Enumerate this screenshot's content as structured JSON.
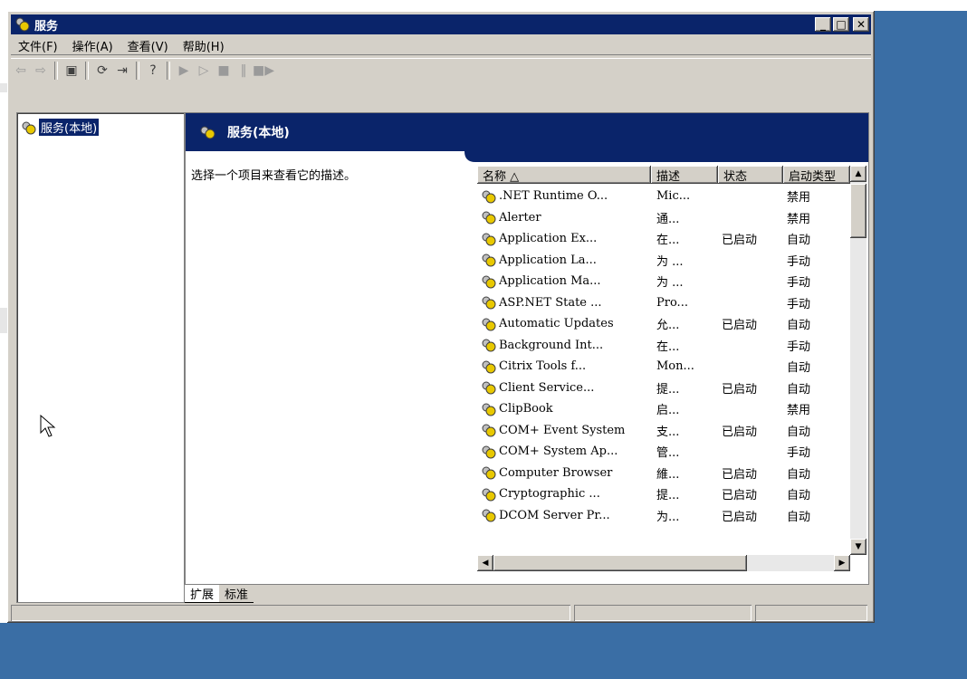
{
  "window": {
    "title": "服务"
  },
  "menu": [
    "文件(F)",
    "操作(A)",
    "查看(V)",
    "帮助(H)"
  ],
  "toolbar": [
    "back-icon",
    "forward-icon",
    "show-hide-tree-icon",
    "refresh-icon",
    "export-list-icon",
    "help-icon",
    "start-service-icon",
    "start-service-alt-icon",
    "stop-service-icon",
    "pause-service-icon",
    "restart-service-icon"
  ],
  "tree": {
    "selected": "服务(本地)"
  },
  "panel": {
    "title": "服务(本地)",
    "description_prompt": "选择一个项目来查看它的描述。"
  },
  "list": {
    "columns": [
      "名称 △",
      "描述",
      "状态",
      "启动类型"
    ],
    "rows": [
      {
        "name": ".NET Runtime O...",
        "desc": "Mic...",
        "state": "",
        "start": "禁用"
      },
      {
        "name": "Alerter",
        "desc": "通...",
        "state": "",
        "start": "禁用"
      },
      {
        "name": "Application Ex...",
        "desc": "在...",
        "state": "已启动",
        "start": "自动"
      },
      {
        "name": "Application La...",
        "desc": "为 ...",
        "state": "",
        "start": "手动"
      },
      {
        "name": "Application Ma...",
        "desc": "为 ...",
        "state": "",
        "start": "手动"
      },
      {
        "name": "ASP.NET State ...",
        "desc": "Pro...",
        "state": "",
        "start": "手动"
      },
      {
        "name": "Automatic Updates",
        "desc": "允...",
        "state": "已启动",
        "start": "自动"
      },
      {
        "name": "Background Int...",
        "desc": "在...",
        "state": "",
        "start": "手动"
      },
      {
        "name": "Citrix Tools f...",
        "desc": "Mon...",
        "state": "",
        "start": "自动"
      },
      {
        "name": "Client Service...",
        "desc": "提...",
        "state": "已启动",
        "start": "自动"
      },
      {
        "name": "ClipBook",
        "desc": "启...",
        "state": "",
        "start": "禁用"
      },
      {
        "name": "COM+ Event System",
        "desc": "支...",
        "state": "已启动",
        "start": "自动"
      },
      {
        "name": "COM+ System Ap...",
        "desc": "管...",
        "state": "",
        "start": "手动"
      },
      {
        "name": "Computer Browser",
        "desc": "維...",
        "state": "已启动",
        "start": "自动"
      },
      {
        "name": "Cryptographic ...",
        "desc": "提...",
        "state": "已启动",
        "start": "自动"
      },
      {
        "name": "DCOM Server Pr...",
        "desc": "为...",
        "state": "已启动",
        "start": "自动"
      }
    ]
  },
  "tabs": [
    "扩展",
    "标准"
  ],
  "colors": {
    "title_bar": "#0a246a",
    "desktop": "#3a6ea5",
    "chrome": "#d4d0c8"
  }
}
